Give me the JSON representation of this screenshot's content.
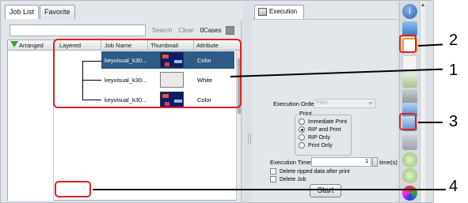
{
  "left_panel": {
    "tabs": [
      {
        "label": "Job List"
      },
      {
        "label": "Favorite"
      }
    ],
    "search": {
      "value": "",
      "search_label": "Search",
      "clear_label": "Clear",
      "cases_label": "0Cases"
    },
    "columns": {
      "arranged": "Arranged",
      "layered": "Layered",
      "job_name": "Job Name",
      "thumbnail": "Thumbnail",
      "attribute": "Attribute"
    },
    "rows": [
      {
        "job_name": "keyvisual_k30...",
        "attribute": "Color",
        "selected": true
      },
      {
        "job_name": "keyvisual_k30...",
        "attribute": "White",
        "selected": false
      },
      {
        "job_name": "keyvisual_k30...",
        "attribute": "Color",
        "selected": false
      }
    ]
  },
  "right_panel": {
    "tab_label": "Execution",
    "execution_order": {
      "label": "Execution Order",
      "value": "Print"
    },
    "print_group": {
      "label": "Print",
      "options": [
        {
          "label": "Immediate Print",
          "selected": false
        },
        {
          "label": "RIP and Print",
          "selected": true
        },
        {
          "label": "RIP Only",
          "selected": false
        },
        {
          "label": "Print Only",
          "selected": false
        }
      ]
    },
    "execution_times": {
      "label": "Execution Times",
      "value": "1",
      "unit": "time(s)"
    },
    "checkboxes": [
      {
        "label": "Delete ripped data after print",
        "checked": false
      },
      {
        "label": "Delete Job",
        "checked": false
      }
    ],
    "start_label": "Start"
  },
  "toolbar": {
    "tools": [
      {
        "icon": "info-icon"
      },
      {
        "icon": "job-settings-icon"
      },
      {
        "icon": "highlighted-tool-icon"
      },
      {
        "icon": "blank-tool-icon"
      },
      {
        "icon": "edit-page-icon"
      },
      {
        "icon": "gray-tool-icon"
      },
      {
        "icon": "grid-layout-icon"
      },
      {
        "icon": "execution-panel-icon"
      },
      {
        "icon": "disabled-tool-icon"
      },
      {
        "icon": "move-down-icon"
      },
      {
        "icon": "move-updown-icon"
      },
      {
        "icon": "palette-icon"
      }
    ]
  },
  "callouts": [
    {
      "number": "1"
    },
    {
      "number": "2"
    },
    {
      "number": "3"
    },
    {
      "number": "4"
    }
  ],
  "colors": {
    "highlight_red": "#e02020",
    "selection_blue": "#2d5b86",
    "arrow_green": "#34a234"
  }
}
